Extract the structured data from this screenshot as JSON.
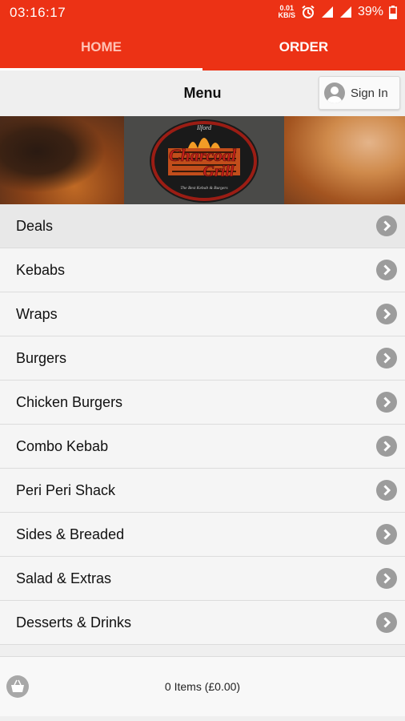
{
  "status_bar": {
    "time": "03:16:17",
    "net_speed_value": "0.01",
    "net_speed_unit": "KB/S",
    "battery": "39%"
  },
  "tabs": [
    {
      "label": "HOME"
    },
    {
      "label": "ORDER"
    }
  ],
  "header": {
    "title": "Menu",
    "sign_in_label": "Sign In"
  },
  "banner": {
    "logo_text_top": "Ilford",
    "logo_text_main_1": "Charcoal",
    "logo_text_main_2": "Grill",
    "logo_text_bottom": "The Best Kebab & Burgers"
  },
  "menu_items": [
    {
      "label": "Deals"
    },
    {
      "label": "Kebabs"
    },
    {
      "label": "Wraps"
    },
    {
      "label": "Burgers"
    },
    {
      "label": "Chicken Burgers"
    },
    {
      "label": "Combo Kebab"
    },
    {
      "label": "Peri Peri Shack"
    },
    {
      "label": "Sides & Breaded"
    },
    {
      "label": "Salad & Extras"
    },
    {
      "label": "Desserts & Drinks"
    }
  ],
  "footer": {
    "cart_summary": "0 Items (£0.00)"
  },
  "colors": {
    "brand_red": "#ec3215",
    "chevron_grey": "#9c9c9c"
  }
}
